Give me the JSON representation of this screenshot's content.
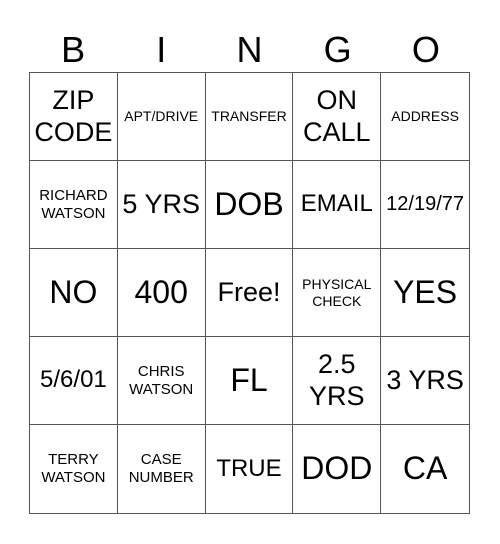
{
  "header": {
    "letters": [
      "B",
      "I",
      "N",
      "G",
      "O"
    ]
  },
  "card": {
    "cells": [
      {
        "text": "ZIP CODE",
        "size": "l"
      },
      {
        "text": "APT/DRIVE",
        "size": "xxs"
      },
      {
        "text": "TRANSFER",
        "size": "xxs"
      },
      {
        "text": "ON CALL",
        "size": "l"
      },
      {
        "text": "ADDRESS",
        "size": "xxs"
      },
      {
        "text": "RICHARD WATSON",
        "size": "xs"
      },
      {
        "text": "5 YRS",
        "size": "l"
      },
      {
        "text": "DOB",
        "size": "xl"
      },
      {
        "text": "EMAIL",
        "size": "m"
      },
      {
        "text": "12/19/77",
        "size": "s"
      },
      {
        "text": "NO",
        "size": "xl"
      },
      {
        "text": "400",
        "size": "xl"
      },
      {
        "text": "Free!",
        "size": "l"
      },
      {
        "text": "PHYSICAL CHECK",
        "size": "xxs"
      },
      {
        "text": "YES",
        "size": "xl"
      },
      {
        "text": "5/6/01",
        "size": "m"
      },
      {
        "text": "CHRIS WATSON",
        "size": "xs"
      },
      {
        "text": "FL",
        "size": "xl"
      },
      {
        "text": "2.5 YRS",
        "size": "l"
      },
      {
        "text": "3 YRS",
        "size": "l"
      },
      {
        "text": "TERRY WATSON",
        "size": "xs"
      },
      {
        "text": "CASE NUMBER",
        "size": "xs"
      },
      {
        "text": "TRUE",
        "size": "m"
      },
      {
        "text": "DOD",
        "size": "xl"
      },
      {
        "text": "CA",
        "size": "xl"
      }
    ]
  }
}
